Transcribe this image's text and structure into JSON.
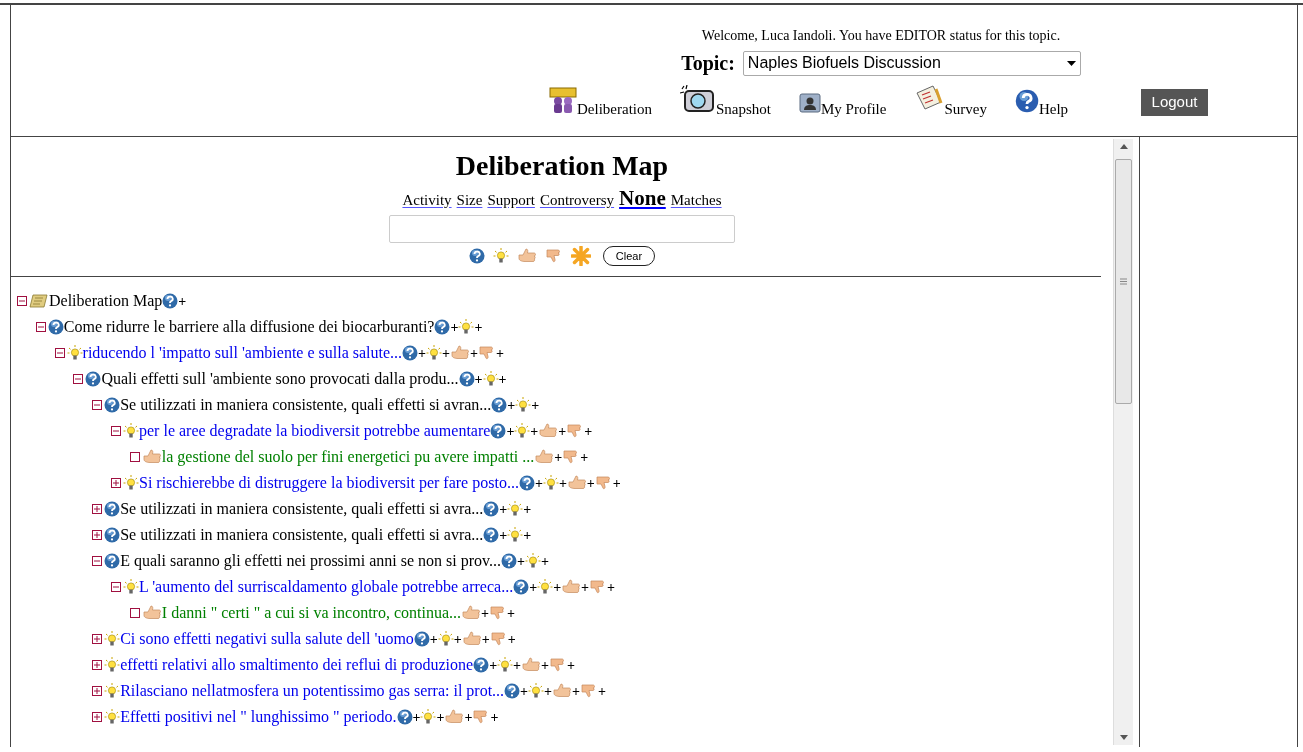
{
  "header": {
    "welcome": "Welcome, Luca Iandoli. You have EDITOR status for this topic.",
    "topic_label": "Topic:",
    "topic_value": "Naples Biofuels Discussion",
    "nav": [
      {
        "kind": "deliberation",
        "label": "Deliberation"
      },
      {
        "kind": "snapshot",
        "label": "Snapshot"
      },
      {
        "kind": "profile",
        "label": "My Profile"
      },
      {
        "kind": "survey",
        "label": "Survey"
      },
      {
        "kind": "help",
        "label": "Help"
      }
    ],
    "logout": "Logout"
  },
  "map": {
    "title": "Deliberation Map",
    "sort_links": [
      {
        "label": "Activity",
        "selected": false
      },
      {
        "label": "Size",
        "selected": false
      },
      {
        "label": "Support",
        "selected": false
      },
      {
        "label": "Controversy",
        "selected": false
      },
      {
        "label": "None",
        "selected": true
      },
      {
        "label": "Matches",
        "selected": false
      }
    ],
    "filters": [
      {
        "kind": "question"
      },
      {
        "kind": "idea"
      },
      {
        "kind": "pro"
      },
      {
        "kind": "con"
      },
      {
        "kind": "all"
      }
    ],
    "clear": "Clear"
  },
  "tree": [
    {
      "kind": "map",
      "text": "Deliberation Map",
      "expanded": true,
      "actions": [
        {
          "kind": "question",
          "label": "+"
        }
      ],
      "children": [
        {
          "kind": "question",
          "text": "Come ridurre le barriere alla diffusione dei biocarburanti?",
          "expanded": true,
          "actions": [
            {
              "kind": "question",
              "label": "+"
            },
            {
              "kind": "idea",
              "label": "+"
            }
          ],
          "children": [
            {
              "kind": "idea",
              "text": "riducendo l 'impatto sull 'ambiente e sulla salute...",
              "expanded": true,
              "actions": [
                {
                  "kind": "question",
                  "label": "+"
                },
                {
                  "kind": "idea",
                  "label": "+"
                },
                {
                  "kind": "pro",
                  "label": "+"
                },
                {
                  "kind": "con",
                  "label": "+"
                }
              ],
              "children": [
                {
                  "kind": "question",
                  "text": "Quali effetti sull 'ambiente sono provocati dalla produ...",
                  "expanded": true,
                  "actions": [
                    {
                      "kind": "question",
                      "label": "+"
                    },
                    {
                      "kind": "idea",
                      "label": "+"
                    }
                  ],
                  "children": [
                    {
                      "kind": "question",
                      "text": "Se utilizzati in maniera consistente, quali effetti si avran...",
                      "expanded": true,
                      "actions": [
                        {
                          "kind": "question",
                          "label": "+"
                        },
                        {
                          "kind": "idea",
                          "label": "+"
                        }
                      ],
                      "children": [
                        {
                          "kind": "idea",
                          "text": "per le aree degradate la biodiversit potrebbe aumentare",
                          "expanded": true,
                          "actions": [
                            {
                              "kind": "question",
                              "label": "+"
                            },
                            {
                              "kind": "idea",
                              "label": "+"
                            },
                            {
                              "kind": "pro",
                              "label": "+"
                            },
                            {
                              "kind": "con",
                              "label": "+"
                            }
                          ],
                          "children": [
                            {
                              "kind": "pro",
                              "text": "la gestione del suolo per fini energetici pu avere impatti ...",
                              "actions": [
                                {
                                  "kind": "pro",
                                  "label": "+"
                                },
                                {
                                  "kind": "con",
                                  "label": "+"
                                }
                              ]
                            }
                          ]
                        },
                        {
                          "kind": "idea",
                          "text": "Si rischierebbe di distruggere la biodiversit per fare posto...",
                          "expanded": false,
                          "actions": [
                            {
                              "kind": "question",
                              "label": "+"
                            },
                            {
                              "kind": "idea",
                              "label": "+"
                            },
                            {
                              "kind": "pro",
                              "label": "+"
                            },
                            {
                              "kind": "con",
                              "label": "+"
                            }
                          ]
                        }
                      ]
                    },
                    {
                      "kind": "question",
                      "text": "Se utilizzati in maniera consistente, quali effetti si avra...",
                      "expanded": false,
                      "actions": [
                        {
                          "kind": "question",
                          "label": "+"
                        },
                        {
                          "kind": "idea",
                          "label": "+"
                        }
                      ]
                    },
                    {
                      "kind": "question",
                      "text": "Se utilizzati in maniera consistente, quali effetti si avra...",
                      "expanded": false,
                      "actions": [
                        {
                          "kind": "question",
                          "label": "+"
                        },
                        {
                          "kind": "idea",
                          "label": "+"
                        }
                      ]
                    },
                    {
                      "kind": "question",
                      "text": "E quali saranno gli effetti nei prossimi anni se non si prov...",
                      "expanded": true,
                      "actions": [
                        {
                          "kind": "question",
                          "label": "+"
                        },
                        {
                          "kind": "idea",
                          "label": "+"
                        }
                      ],
                      "children": [
                        {
                          "kind": "idea",
                          "text": "L 'aumento del surriscaldamento globale potrebbe arreca...",
                          "expanded": true,
                          "actions": [
                            {
                              "kind": "question",
                              "label": "+"
                            },
                            {
                              "kind": "idea",
                              "label": "+"
                            },
                            {
                              "kind": "pro",
                              "label": "+"
                            },
                            {
                              "kind": "con",
                              "label": "+"
                            }
                          ],
                          "children": [
                            {
                              "kind": "pro",
                              "text": "I danni \" certi \" a cui si va incontro, continua...",
                              "actions": [
                                {
                                  "kind": "pro",
                                  "label": "+"
                                },
                                {
                                  "kind": "con",
                                  "label": "+"
                                }
                              ]
                            }
                          ]
                        }
                      ]
                    },
                    {
                      "kind": "idea",
                      "text": "Ci sono effetti negativi sulla salute dell 'uomo",
                      "expanded": false,
                      "actions": [
                        {
                          "kind": "question",
                          "label": "+"
                        },
                        {
                          "kind": "idea",
                          "label": "+"
                        },
                        {
                          "kind": "pro",
                          "label": "+"
                        },
                        {
                          "kind": "con",
                          "label": "+"
                        }
                      ]
                    },
                    {
                      "kind": "idea",
                      "text": "effetti relativi allo smaltimento dei reflui di produzione",
                      "expanded": false,
                      "actions": [
                        {
                          "kind": "question",
                          "label": "+"
                        },
                        {
                          "kind": "idea",
                          "label": "+"
                        },
                        {
                          "kind": "pro",
                          "label": "+"
                        },
                        {
                          "kind": "con",
                          "label": "+"
                        }
                      ]
                    },
                    {
                      "kind": "idea",
                      "text": "Rilasciano nellatmosfera un potentissimo gas serra: il prot...",
                      "expanded": false,
                      "actions": [
                        {
                          "kind": "question",
                          "label": "+"
                        },
                        {
                          "kind": "idea",
                          "label": "+"
                        },
                        {
                          "kind": "pro",
                          "label": "+"
                        },
                        {
                          "kind": "con",
                          "label": "+"
                        }
                      ]
                    },
                    {
                      "kind": "idea",
                      "text": "Effetti positivi nel \" lunghissimo \" periodo.",
                      "expanded": false,
                      "actions": [
                        {
                          "kind": "question",
                          "label": "+"
                        },
                        {
                          "kind": "idea",
                          "label": "+"
                        },
                        {
                          "kind": "pro",
                          "label": "+"
                        },
                        {
                          "kind": "con",
                          "label": "+"
                        }
                      ]
                    }
                  ]
                }
              ]
            }
          ]
        }
      ]
    }
  ]
}
